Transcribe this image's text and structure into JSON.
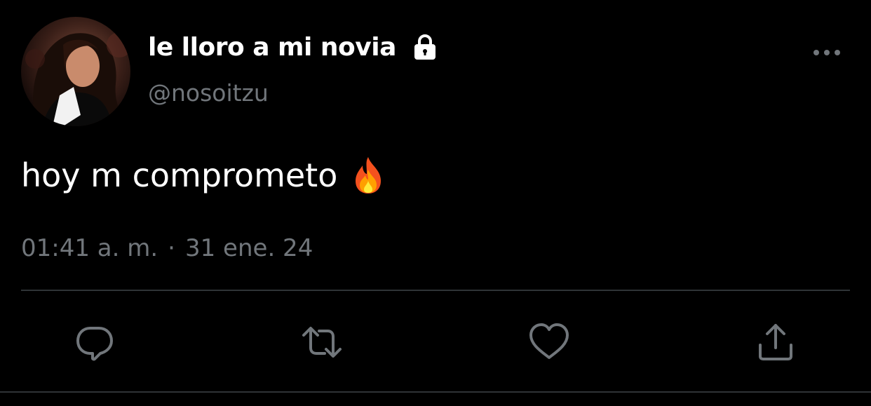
{
  "tweet": {
    "author": {
      "display_name": "le lloro a mi novia",
      "handle": "@nosoitzu",
      "protected_icon": "lock-icon",
      "avatar_icon": "avatar"
    },
    "text": "hoy m comprometo",
    "emoji": "🔥",
    "timestamp": {
      "time": "01:41 a. m.",
      "separator": "·",
      "date": "31 ene. 24"
    },
    "more_icon": "more-options-icon",
    "actions": [
      {
        "name": "reply",
        "icon": "reply-icon"
      },
      {
        "name": "retweet",
        "icon": "retweet-icon"
      },
      {
        "name": "like",
        "icon": "heart-icon"
      },
      {
        "name": "share",
        "icon": "share-icon"
      }
    ]
  },
  "colors": {
    "background": "#000000",
    "primary_text": "#ffffff",
    "secondary_text": "#71767b",
    "divider": "#2f3336",
    "icon": "#71767b"
  }
}
